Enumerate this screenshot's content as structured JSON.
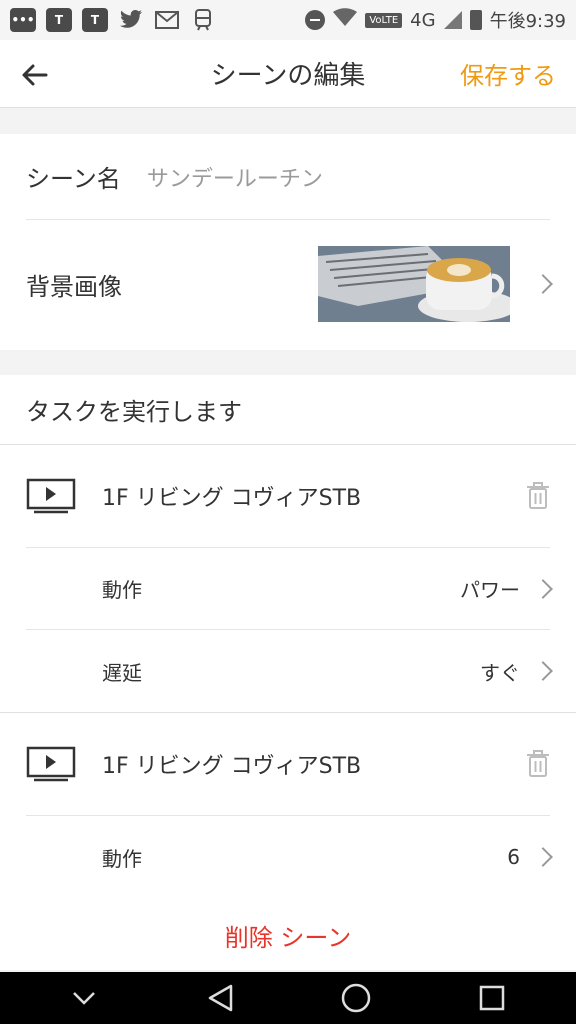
{
  "status_bar": {
    "volte": "VoLTE",
    "network": "4G",
    "time": "午後9:39"
  },
  "app_bar": {
    "title": "シーンの編集",
    "save_label": "保存する"
  },
  "scene": {
    "name_label": "シーン名",
    "name_value": "サンデールーチン",
    "background_label": "背景画像"
  },
  "tasks": {
    "header": "タスクを実行します",
    "items": [
      {
        "device": "1F リビング コヴィアSTB",
        "params": [
          {
            "label": "動作",
            "value": "パワー"
          },
          {
            "label": "遅延",
            "value": "すぐ"
          }
        ]
      },
      {
        "device": "1F リビング コヴィアSTB",
        "params": [
          {
            "label": "動作",
            "value": "6"
          }
        ]
      }
    ]
  },
  "delete_label": "削除 シーン",
  "colors": {
    "accent": "#f09a12",
    "danger": "#e8342a"
  }
}
